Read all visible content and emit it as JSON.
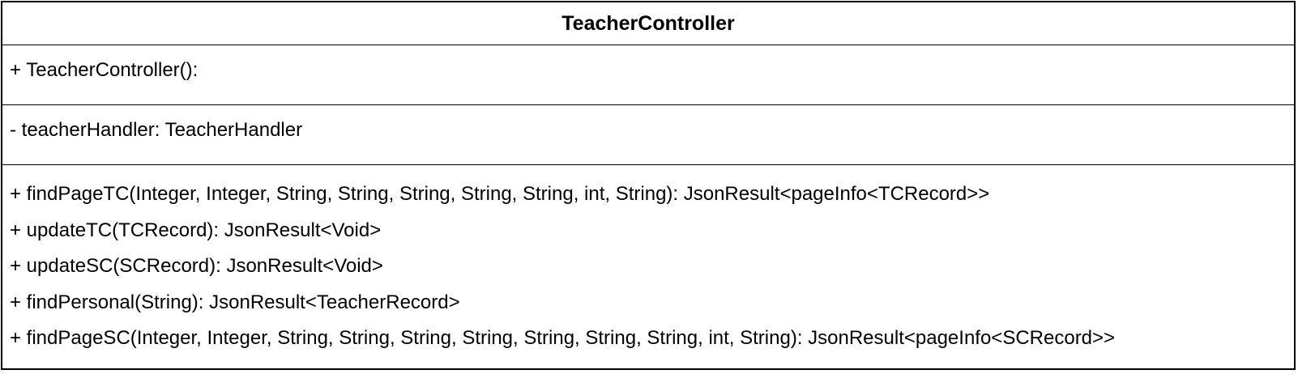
{
  "class": {
    "name": "TeacherController",
    "constructors": [
      "+ TeacherController():"
    ],
    "attributes": [
      "- teacherHandler: TeacherHandler"
    ],
    "methods": [
      "+ findPageTC(Integer, Integer, String, String, String, String, String, int, String): JsonResult<pageInfo<TCRecord>>",
      "+ updateTC(TCRecord): JsonResult<Void>",
      "+ updateSC(SCRecord): JsonResult<Void>",
      "+ findPersonal(String): JsonResult<TeacherRecord>",
      "+ findPageSC(Integer, Integer, String, String, String, String, String, String, String, int, String): JsonResult<pageInfo<SCRecord>>"
    ]
  }
}
